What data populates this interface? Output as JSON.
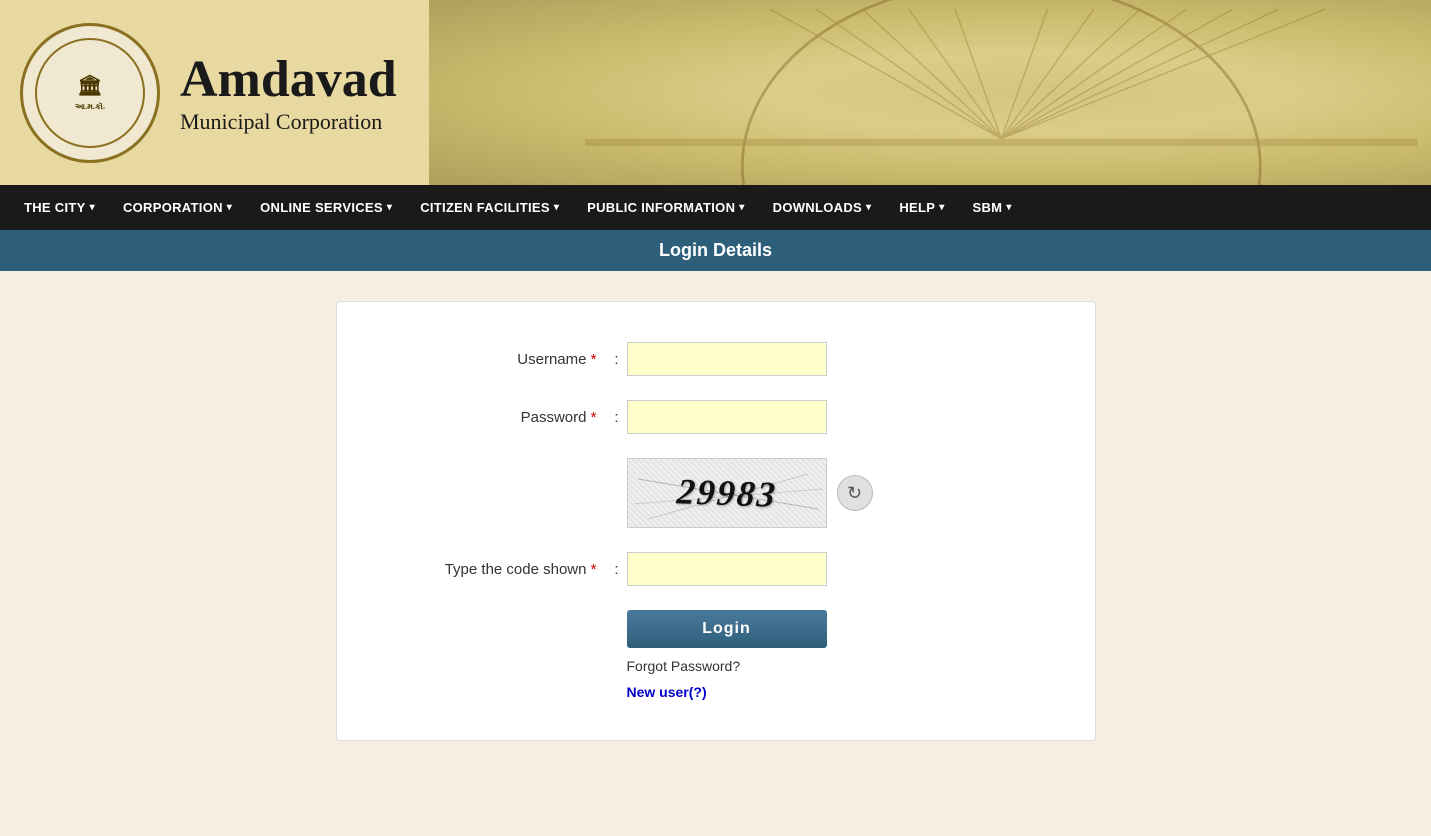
{
  "header": {
    "title": "Amdavad",
    "subtitle": "Municipal Corporation",
    "logo_text": "AMC"
  },
  "nav": {
    "items": [
      {
        "label": "THE CITY",
        "has_dropdown": true
      },
      {
        "label": "CORPORATION",
        "has_dropdown": true
      },
      {
        "label": "ONLINE SERVICES",
        "has_dropdown": true
      },
      {
        "label": "CITIZEN FACILITIES",
        "has_dropdown": true
      },
      {
        "label": "PUBLIC INFORMATION",
        "has_dropdown": true
      },
      {
        "label": "DOWNLOADS",
        "has_dropdown": true
      },
      {
        "label": "HELP",
        "has_dropdown": true
      },
      {
        "label": "SBM",
        "has_dropdown": true
      }
    ]
  },
  "page_title": "Login Details",
  "form": {
    "username_label": "Username",
    "username_required": "*",
    "password_label": "Password",
    "password_required": "*",
    "captcha_value": "29983",
    "captcha_label": "Type the code shown",
    "captcha_required": "*",
    "colon": ":",
    "login_button": "Login",
    "forgot_password": "Forgot Password?",
    "new_user": "New user(?)"
  }
}
